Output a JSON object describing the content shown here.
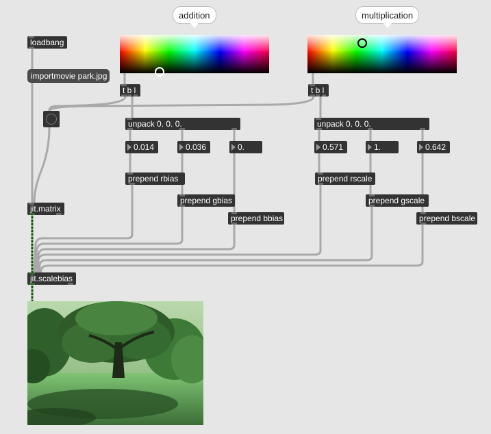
{
  "bubbles": {
    "addition": "addition",
    "multiplication": "multiplication"
  },
  "objects": {
    "loadbang": "loadbang",
    "importmovie": "importmovie park.jpg",
    "tbl_left": "t b l",
    "tbl_right": "t b l",
    "unpack_left": "unpack 0. 0. 0.",
    "unpack_right": "unpack 0. 0. 0.",
    "prepend_rbias": "prepend rbias",
    "prepend_gbias": "prepend gbias",
    "prepend_bbias": "prepend bbias",
    "prepend_rscale": "prepend rscale",
    "prepend_gscale": "prepend gscale",
    "prepend_bscale": "prepend bscale",
    "jit_matrix": "jit.matrix",
    "jit_scalebias": "jit.scalebias"
  },
  "numbers": {
    "rbias": "0.014",
    "gbias": "0.036",
    "bbias": "0.",
    "rscale": "0.571",
    "gscale": "1.",
    "bscale": "0.642"
  },
  "colors": {
    "canvas": "#e6e6e6",
    "object": "#333333",
    "patchcord": "#a8a8a8",
    "matrix_cord": "#2f6b2a"
  },
  "icons": {
    "bang": "bang-button-icon",
    "video": "park-tree-image"
  }
}
